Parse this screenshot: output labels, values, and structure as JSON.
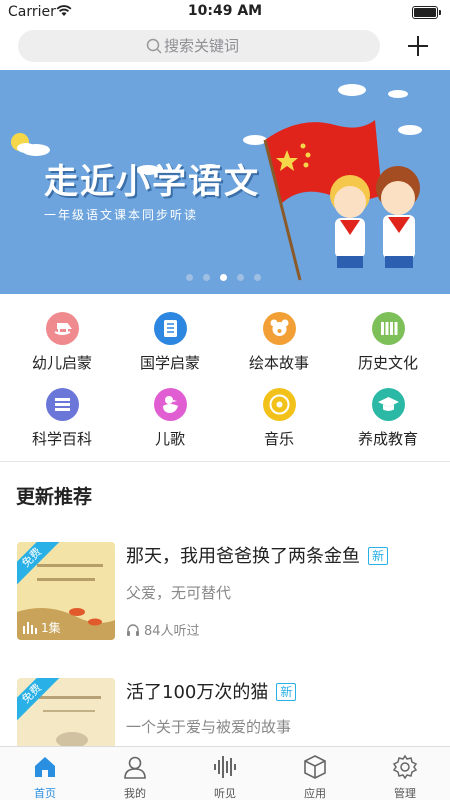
{
  "status_bar": {
    "carrier": "Carrier",
    "time": "10:49 AM"
  },
  "search": {
    "placeholder": "搜索关键词"
  },
  "banner": {
    "title": "走近小学语文",
    "subtitle": "一年级语文课本同步听读",
    "page_count": 5,
    "active_page": 3
  },
  "categories": [
    {
      "label": "幼儿启蒙",
      "icon": "rocking-horse-icon",
      "color": "#ef8a8f"
    },
    {
      "label": "国学启蒙",
      "icon": "book-icon",
      "color": "#2d87e0"
    },
    {
      "label": "绘本故事",
      "icon": "bear-icon",
      "color": "#f2a036"
    },
    {
      "label": "历史文化",
      "icon": "bamboo-scroll-icon",
      "color": "#7dc05a"
    },
    {
      "label": "科学百科",
      "icon": "stack-icon",
      "color": "#6b77d8"
    },
    {
      "label": "儿歌",
      "icon": "duck-icon",
      "color": "#e05ed2"
    },
    {
      "label": "音乐",
      "icon": "music-disc-icon",
      "color": "#f2c21b"
    },
    {
      "label": "养成教育",
      "icon": "graduation-cap-icon",
      "color": "#2bb9a6"
    }
  ],
  "section": {
    "title": "更新推荐"
  },
  "items": [
    {
      "title": "那天，我用爸爸换了两条金鱼",
      "badge": "新",
      "desc": "父爱，无可替代",
      "free_label": "免费",
      "episode_count": "1集",
      "listens": "84人听过"
    },
    {
      "title": "活了100万次的猫",
      "badge": "新",
      "desc": "一个关于爱与被爱的故事",
      "free_label": "免费"
    }
  ],
  "tabs": [
    {
      "label": "首页",
      "icon": "home-icon",
      "active": true
    },
    {
      "label": "我的",
      "icon": "person-icon",
      "active": false
    },
    {
      "label": "听见",
      "icon": "audio-wave-icon",
      "active": false
    },
    {
      "label": "应用",
      "icon": "box-icon",
      "active": false
    },
    {
      "label": "管理",
      "icon": "gear-icon",
      "active": false
    }
  ],
  "colors": {
    "accent": "#2a8fe0",
    "badge": "#29b0e6",
    "banner_bg": "#6da4dd"
  }
}
